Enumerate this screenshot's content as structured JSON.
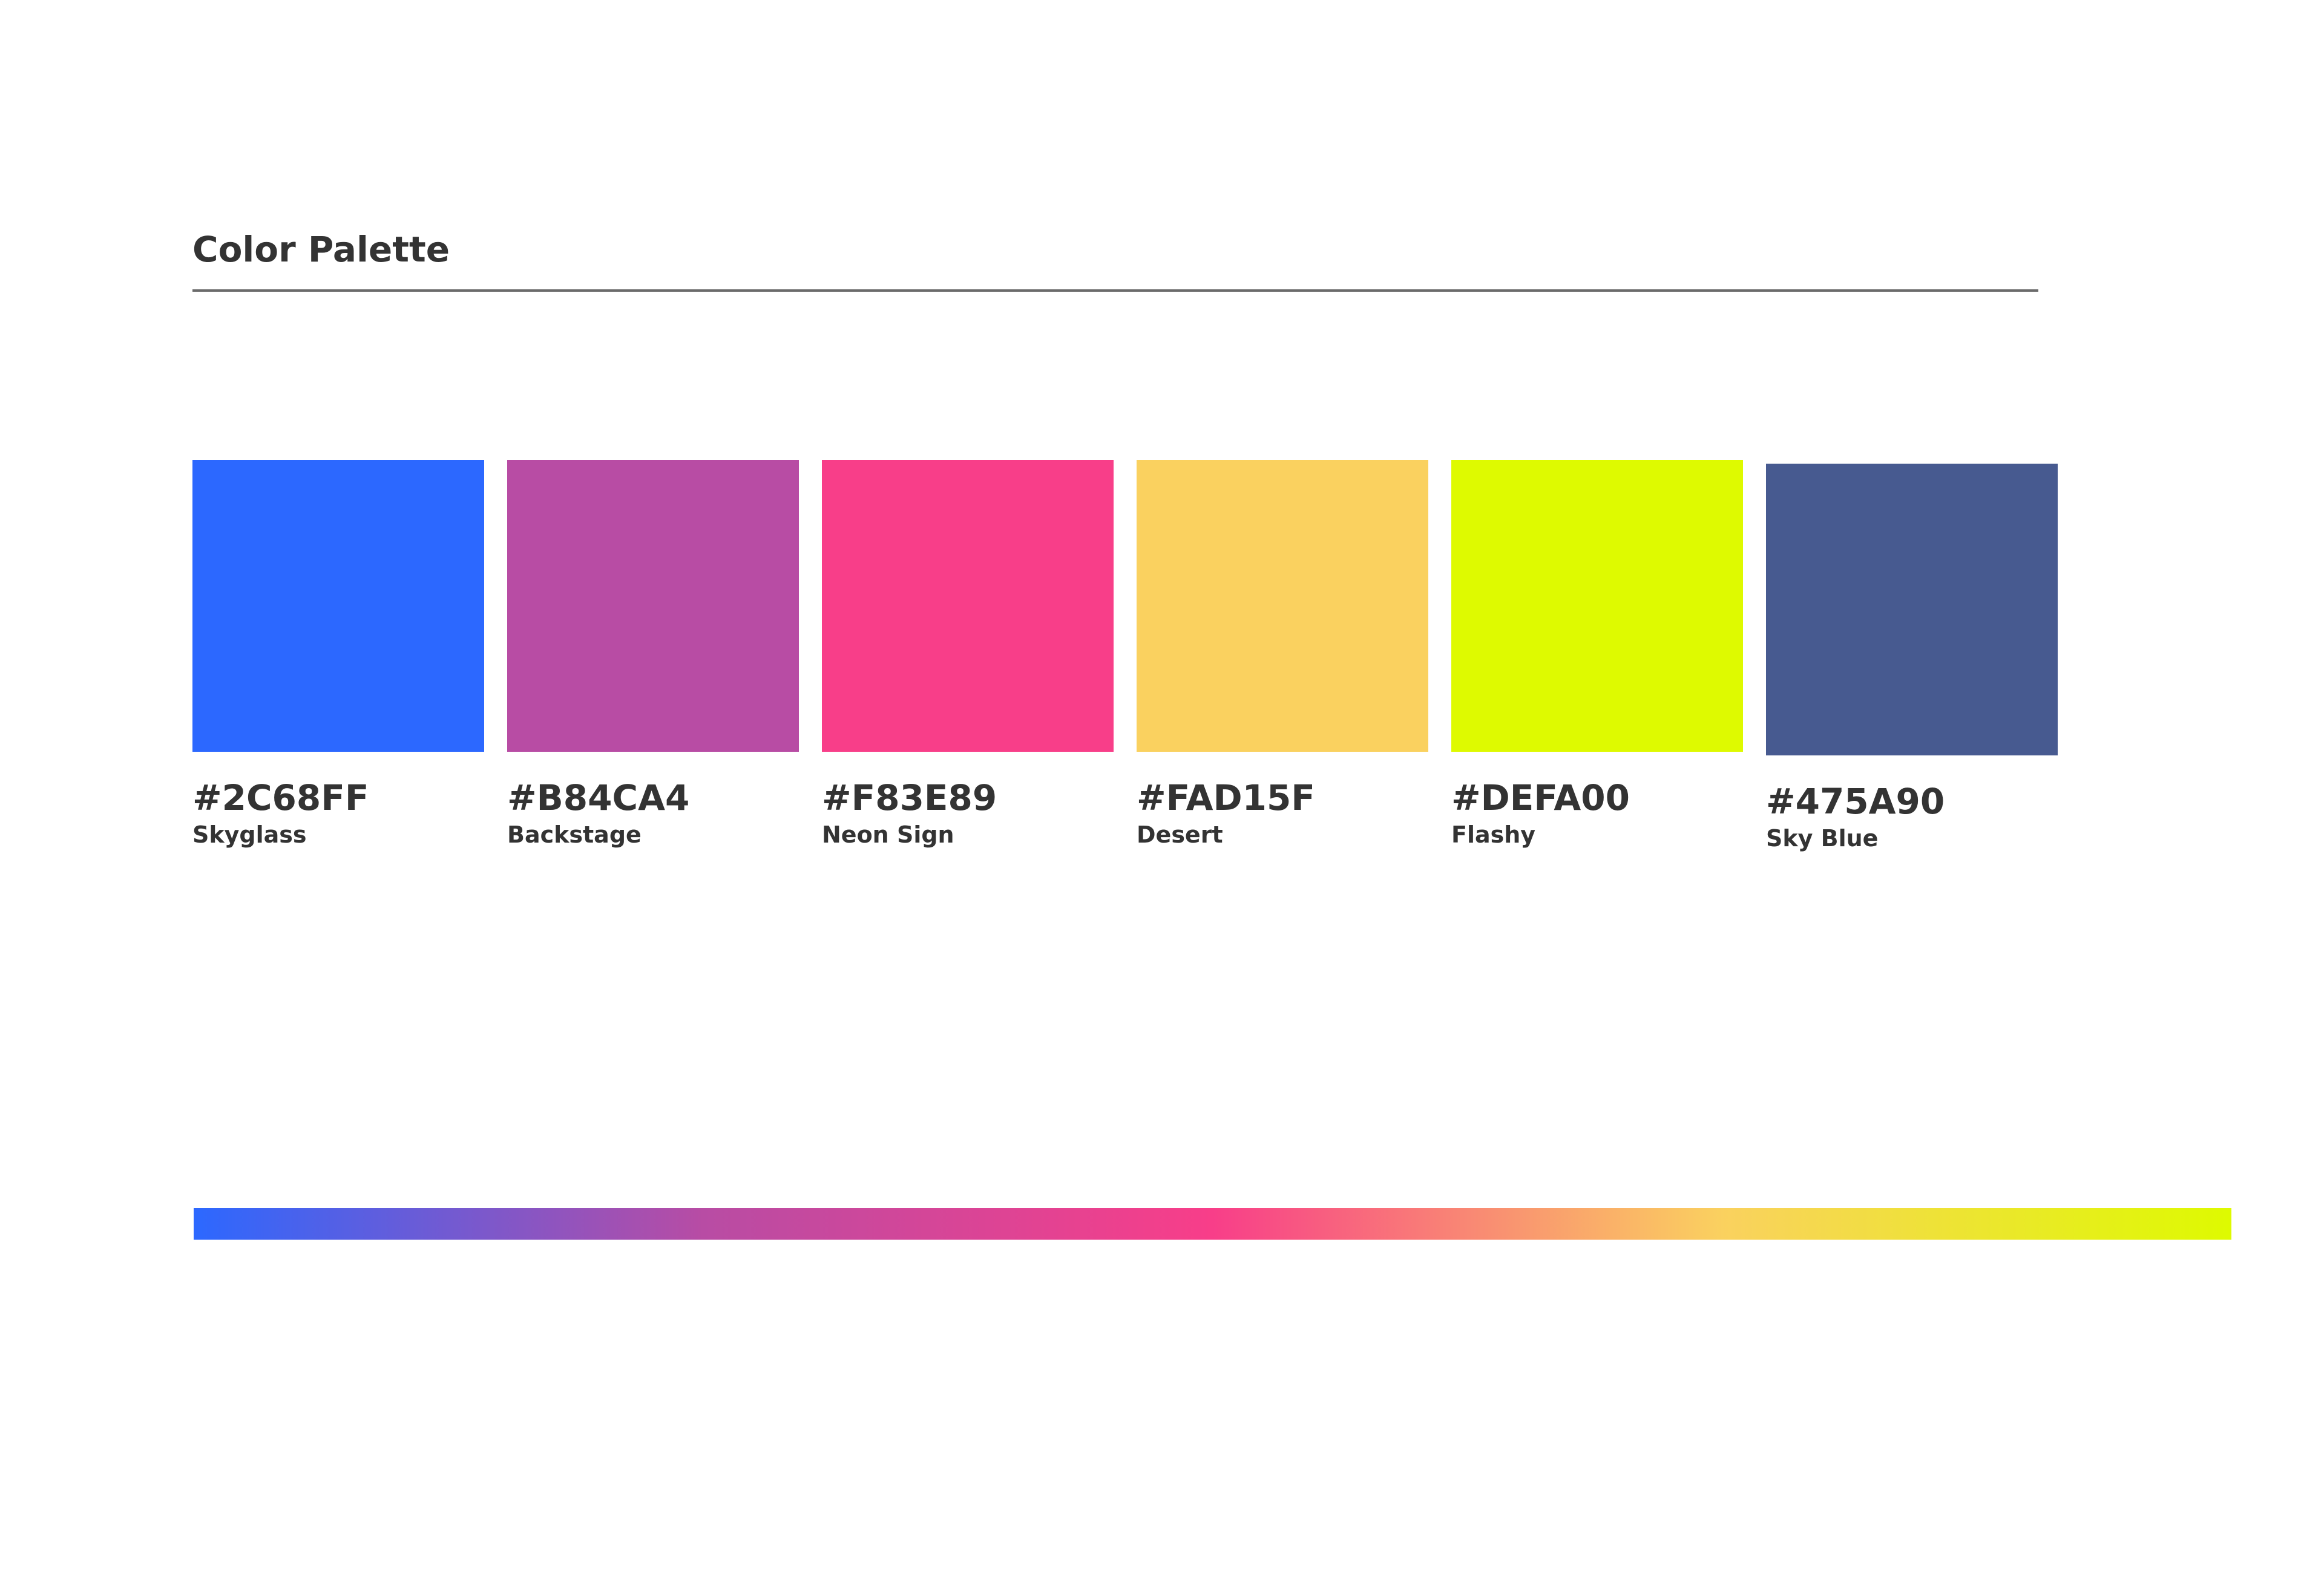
{
  "title": "Color Palette",
  "swatches": [
    {
      "hex": "#2C68FF",
      "name": "Skyglass",
      "color": "#2C68FF"
    },
    {
      "hex": "#B84CA4",
      "name": "Backstage",
      "color": "#B84CA4"
    },
    {
      "hex": "#F83E89",
      "name": "Neon Sign",
      "color": "#F83E89"
    },
    {
      "hex": "#FAD15F",
      "name": "Desert",
      "color": "#FAD15F"
    },
    {
      "hex": "#DEFA00",
      "name": "Flashy",
      "color": "#DEFA00"
    },
    {
      "hex": "#475A90",
      "name": "Sky Blue",
      "color": "#475A90"
    }
  ],
  "gradient_colors": [
    "#2C68FF",
    "#B84CA4",
    "#F83E89",
    "#FAD15F",
    "#DEFA00"
  ]
}
